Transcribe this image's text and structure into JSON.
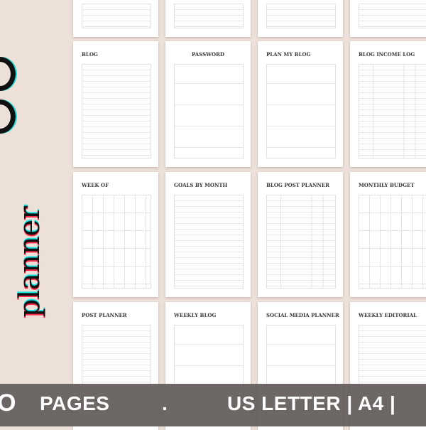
{
  "colors": {
    "background": "#ece0d9",
    "band": "#625d5a",
    "band_text": "#ffffff",
    "title_text": "#3a3a3a"
  },
  "side": {
    "word": "planner"
  },
  "pages": {
    "row1": [
      {
        "title": "BLOG",
        "style": "lines"
      },
      {
        "title": "PASSWORD",
        "style": "boxes",
        "center": true
      },
      {
        "title": "PLAN MY BLOG",
        "style": "boxes"
      },
      {
        "title": "BLOG INCOME LOG",
        "style": "cols"
      }
    ],
    "row2": [
      {
        "title": "WEEK OF",
        "style": "grid"
      },
      {
        "title": "GOALS BY MONTH",
        "style": "lines"
      },
      {
        "title": "BLOG POST PLANNER",
        "style": "cols"
      },
      {
        "title": "MONTHLY BUDGET",
        "style": "grid"
      }
    ],
    "row3": [
      {
        "title": "POST PLANNER",
        "style": "lines"
      },
      {
        "title": "WEEKLY BLOG",
        "style": "boxes"
      },
      {
        "title": "SOCIAL MEDIA PLANNER",
        "style": "boxes"
      },
      {
        "title": "WEEKLY EDITORIAL",
        "style": "lines"
      }
    ]
  },
  "banner": {
    "count": "O",
    "pages_label": "PAGES",
    "separator": ".",
    "formats": "US LETTER | A4 |"
  }
}
